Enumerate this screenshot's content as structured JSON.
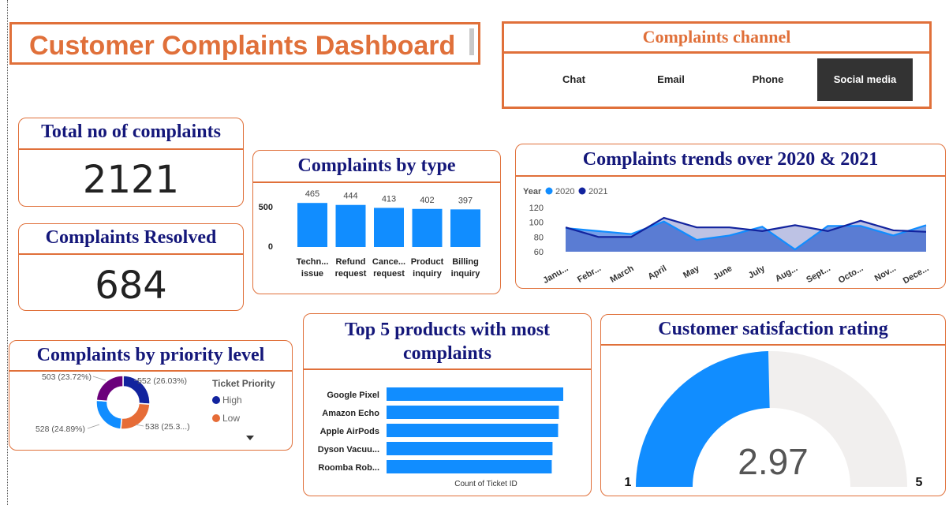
{
  "header": {
    "title": "Customer Complaints Dashboard"
  },
  "channel_slicer": {
    "title": "Complaints channel",
    "options": [
      "Chat",
      "Email",
      "Phone",
      "Social media"
    ],
    "selected": "Social media"
  },
  "kpis": {
    "total": {
      "title": "Total no of complaints",
      "value": "2121"
    },
    "resolved": {
      "title": "Complaints Resolved",
      "value": "684"
    }
  },
  "by_type": {
    "title": "Complaints by type"
  },
  "trends": {
    "title": "Complaints trends over 2020 & 2021"
  },
  "priority": {
    "title": "Complaints by priority level"
  },
  "products": {
    "title": "Top 5 products with most complaints"
  },
  "satisfaction": {
    "title": "Customer satisfaction rating",
    "value": "2.97",
    "min": "1",
    "max": "5"
  },
  "colors": {
    "accent": "#e0703a",
    "title": "#14177a",
    "bar": "#118dff",
    "dark_series": "#12239e",
    "gauge_bg": "#f1efee"
  },
  "chart_data": [
    {
      "id": "by_type",
      "type": "bar",
      "categories": [
        [
          "Techn...",
          "issue"
        ],
        [
          "Refund",
          "request"
        ],
        [
          "Cance...",
          "request"
        ],
        [
          "Product",
          "inquiry"
        ],
        [
          "Billing",
          "inquiry"
        ]
      ],
      "values": [
        465,
        444,
        413,
        402,
        397
      ],
      "data_labels": [
        "465",
        "444",
        "413",
        "402",
        "397"
      ],
      "yticks": [
        "500",
        "0"
      ],
      "ylim": [
        0,
        500
      ]
    },
    {
      "id": "trends",
      "type": "area",
      "legend_title": "Year",
      "categories": [
        "Janu...",
        "Febr...",
        "March",
        "April",
        "May",
        "June",
        "July",
        "Aug...",
        "Sept...",
        "Octo...",
        "Nov...",
        "Dece..."
      ],
      "series": [
        {
          "name": "2020",
          "color": "#118dff",
          "values": [
            92,
            88,
            84,
            101,
            76,
            82,
            94,
            63,
            95,
            95,
            82,
            96
          ]
        },
        {
          "name": "2021",
          "color": "#12239e",
          "values": [
            93,
            80,
            80,
            106,
            93,
            93,
            88,
            96,
            88,
            102,
            89,
            87
          ]
        }
      ],
      "yticks": [
        "120",
        "100",
        "80",
        "60"
      ],
      "ylim": [
        60,
        120
      ]
    },
    {
      "id": "priority",
      "type": "pie",
      "legend_title": "Ticket Priority",
      "legend_entries": [
        {
          "name": "High",
          "color": "#12239e"
        },
        {
          "name": "Low",
          "color": "#e66c37"
        }
      ],
      "slices": [
        {
          "value": 552,
          "color": "#12239e",
          "label": "552 (26.03%)"
        },
        {
          "value": 538,
          "color": "#e66c37",
          "label": "538 (25.3...)"
        },
        {
          "value": 528,
          "color": "#118dff",
          "label": "528 (24.89%)"
        },
        {
          "value": 503,
          "color": "#6b007b",
          "label": "503 (23.72%)"
        }
      ]
    },
    {
      "id": "products",
      "type": "bar",
      "orientation": "horizontal",
      "categories": [
        "Google Pixel",
        "Amazon Echo",
        "Apple AirPods",
        "Dyson Vacuu...",
        "Roomba Rob..."
      ],
      "values": [
        445,
        434,
        432,
        418,
        416
      ],
      "xlabel": "Count of Ticket ID",
      "xlim": [
        0,
        500
      ]
    }
  ]
}
